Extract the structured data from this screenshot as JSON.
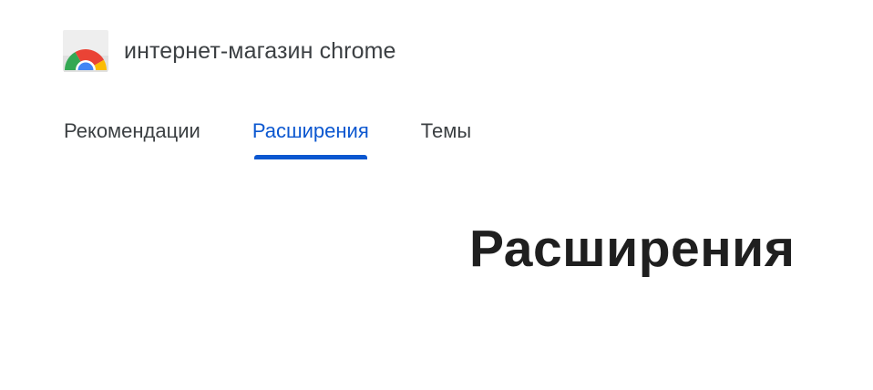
{
  "header": {
    "logo_icon": "chrome-web-store-icon",
    "title": "интернет-магазин chrome"
  },
  "tabs": [
    {
      "label": "Рекомендации",
      "active": false
    },
    {
      "label": "Расширения",
      "active": true
    },
    {
      "label": "Темы",
      "active": false
    }
  ],
  "main": {
    "heading": "Расширения"
  },
  "colors": {
    "accent": "#0b57d0",
    "text": "#3c4043",
    "heading": "#1f1f1f"
  }
}
